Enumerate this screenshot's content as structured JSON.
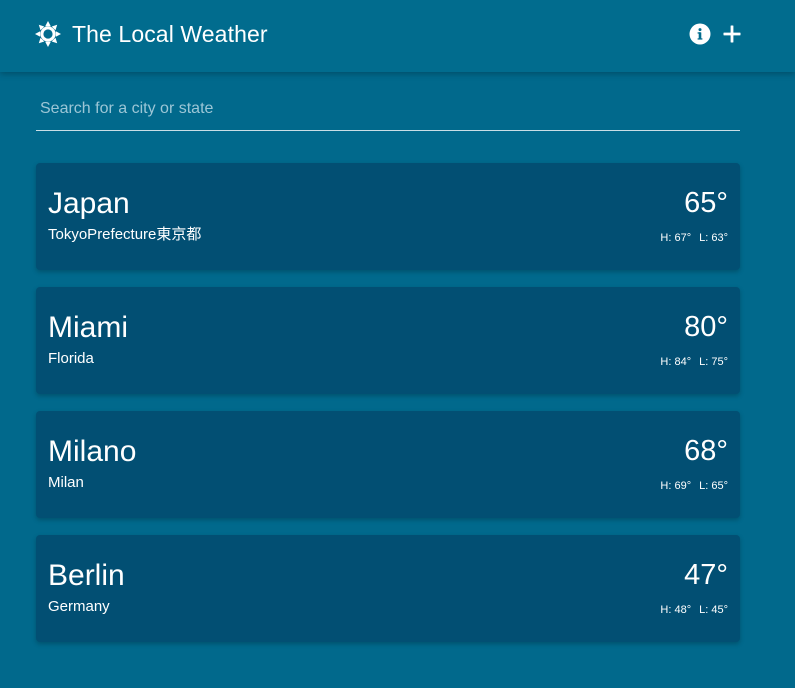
{
  "app": {
    "title": "The Local Weather",
    "logo_icon": "sun-icon"
  },
  "toolbar": {
    "info_icon": "info-icon",
    "add_icon": "plus-icon"
  },
  "search": {
    "placeholder": "Search for a city or state",
    "value": ""
  },
  "colors": {
    "background": "#01698c",
    "card": "#024f73",
    "app_bar": "#016c8e"
  },
  "cities": [
    {
      "name": "Japan",
      "region": "TokyoPrefecture東京都",
      "temp": "65°",
      "high": "H: 67°",
      "low": "L: 63°"
    },
    {
      "name": "Miami",
      "region": "Florida",
      "temp": "80°",
      "high": "H: 84°",
      "low": "L: 75°"
    },
    {
      "name": "Milano",
      "region": "Milan",
      "temp": "68°",
      "high": "H: 69°",
      "low": "L: 65°"
    },
    {
      "name": "Berlin",
      "region": "Germany",
      "temp": "47°",
      "high": "H: 48°",
      "low": "L: 45°"
    }
  ]
}
